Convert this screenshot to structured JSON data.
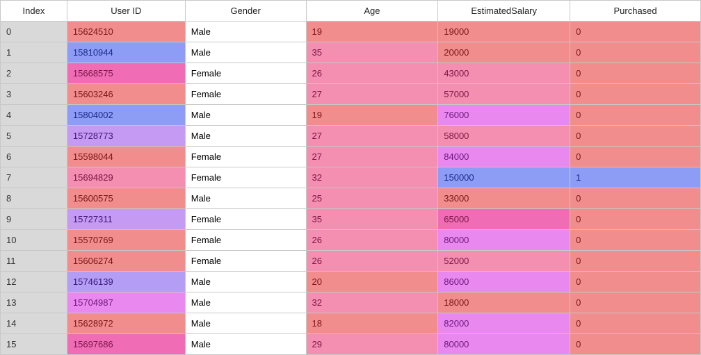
{
  "headers": {
    "index": "Index",
    "userid": "User ID",
    "gender": "Gender",
    "age": "Age",
    "salary": "EstimatedSalary",
    "purchased": "Purchased"
  },
  "rows": [
    {
      "index": "0",
      "userid": "15624510",
      "userid_h": "h-salmon",
      "gender": "Male",
      "age": "19",
      "age_h": "h-salmon",
      "salary": "19000",
      "salary_h": "h-salmon",
      "purchased": "0",
      "purchased_h": "h-salmon"
    },
    {
      "index": "1",
      "userid": "15810944",
      "userid_h": "h-blue",
      "gender": "Male",
      "age": "35",
      "age_h": "h-pink",
      "salary": "20000",
      "salary_h": "h-salmon",
      "purchased": "0",
      "purchased_h": "h-salmon"
    },
    {
      "index": "2",
      "userid": "15668575",
      "userid_h": "h-hotpink",
      "gender": "Female",
      "age": "26",
      "age_h": "h-pink",
      "salary": "43000",
      "salary_h": "h-pink",
      "purchased": "0",
      "purchased_h": "h-salmon"
    },
    {
      "index": "3",
      "userid": "15603246",
      "userid_h": "h-salmon",
      "gender": "Female",
      "age": "27",
      "age_h": "h-pink",
      "salary": "57000",
      "salary_h": "h-pink",
      "purchased": "0",
      "purchased_h": "h-salmon"
    },
    {
      "index": "4",
      "userid": "15804002",
      "userid_h": "h-blue",
      "gender": "Male",
      "age": "19",
      "age_h": "h-salmon",
      "salary": "76000",
      "salary_h": "h-magenta",
      "purchased": "0",
      "purchased_h": "h-salmon"
    },
    {
      "index": "5",
      "userid": "15728773",
      "userid_h": "h-violet",
      "gender": "Male",
      "age": "27",
      "age_h": "h-pink",
      "salary": "58000",
      "salary_h": "h-pink",
      "purchased": "0",
      "purchased_h": "h-salmon"
    },
    {
      "index": "6",
      "userid": "15598044",
      "userid_h": "h-salmon",
      "gender": "Female",
      "age": "27",
      "age_h": "h-pink",
      "salary": "84000",
      "salary_h": "h-magenta",
      "purchased": "0",
      "purchased_h": "h-salmon"
    },
    {
      "index": "7",
      "userid": "15694829",
      "userid_h": "h-pink",
      "gender": "Female",
      "age": "32",
      "age_h": "h-pink",
      "salary": "150000",
      "salary_h": "h-blue",
      "purchased": "1",
      "purchased_h": "h-blue"
    },
    {
      "index": "8",
      "userid": "15600575",
      "userid_h": "h-salmon",
      "gender": "Male",
      "age": "25",
      "age_h": "h-pink",
      "salary": "33000",
      "salary_h": "h-salmon",
      "purchased": "0",
      "purchased_h": "h-salmon"
    },
    {
      "index": "9",
      "userid": "15727311",
      "userid_h": "h-violet",
      "gender": "Female",
      "age": "35",
      "age_h": "h-pink",
      "salary": "65000",
      "salary_h": "h-hotpink",
      "purchased": "0",
      "purchased_h": "h-salmon"
    },
    {
      "index": "10",
      "userid": "15570769",
      "userid_h": "h-salmon",
      "gender": "Female",
      "age": "26",
      "age_h": "h-pink",
      "salary": "80000",
      "salary_h": "h-magenta",
      "purchased": "0",
      "purchased_h": "h-salmon"
    },
    {
      "index": "11",
      "userid": "15606274",
      "userid_h": "h-salmon",
      "gender": "Female",
      "age": "26",
      "age_h": "h-pink",
      "salary": "52000",
      "salary_h": "h-pink",
      "purchased": "0",
      "purchased_h": "h-salmon"
    },
    {
      "index": "12",
      "userid": "15746139",
      "userid_h": "h-lilac",
      "gender": "Male",
      "age": "20",
      "age_h": "h-salmon",
      "salary": "86000",
      "salary_h": "h-magenta",
      "purchased": "0",
      "purchased_h": "h-salmon"
    },
    {
      "index": "13",
      "userid": "15704987",
      "userid_h": "h-magenta",
      "gender": "Male",
      "age": "32",
      "age_h": "h-pink",
      "salary": "18000",
      "salary_h": "h-salmon",
      "purchased": "0",
      "purchased_h": "h-salmon"
    },
    {
      "index": "14",
      "userid": "15628972",
      "userid_h": "h-salmon",
      "gender": "Male",
      "age": "18",
      "age_h": "h-salmon",
      "salary": "82000",
      "salary_h": "h-magenta",
      "purchased": "0",
      "purchased_h": "h-salmon"
    },
    {
      "index": "15",
      "userid": "15697686",
      "userid_h": "h-hotpink",
      "gender": "Male",
      "age": "29",
      "age_h": "h-pink",
      "salary": "80000",
      "salary_h": "h-magenta",
      "purchased": "0",
      "purchased_h": "h-salmon"
    }
  ]
}
